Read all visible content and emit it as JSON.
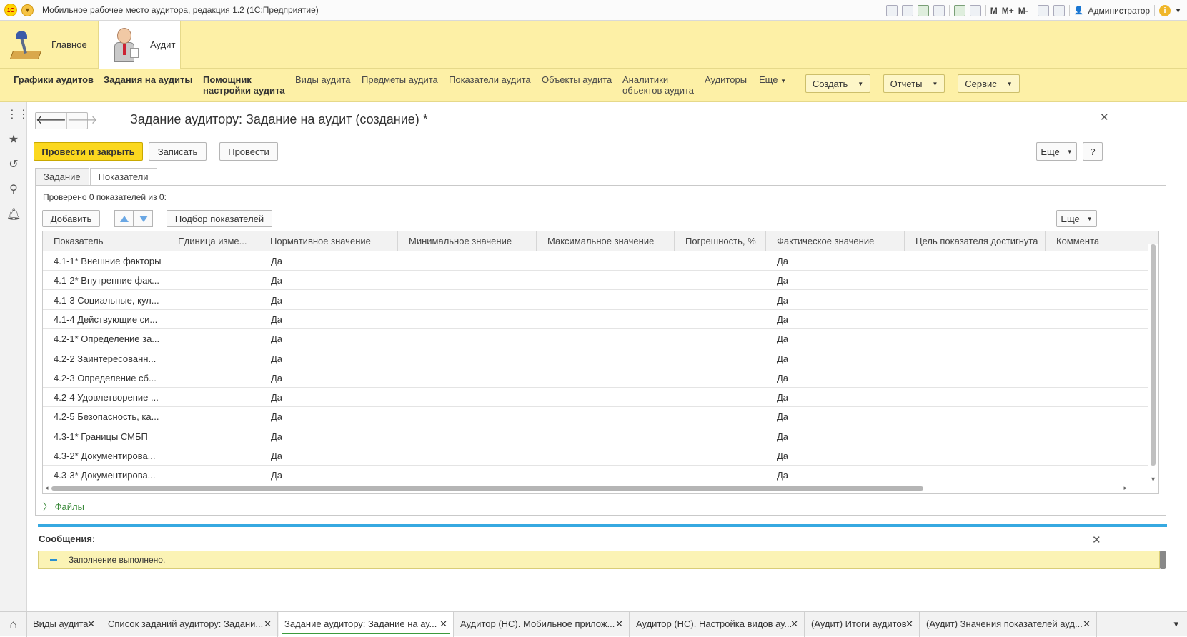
{
  "window": {
    "title": "Мобильное рабочее место аудитора, редакция 1.2  (1С:Предприятие)",
    "toolbar_texts": [
      "M",
      "M+",
      "M-"
    ],
    "user": "Администратор"
  },
  "sections": [
    {
      "label": "Главное",
      "icon": "desk-lamp-icon"
    },
    {
      "label": "Аудит",
      "icon": "auditor-icon"
    }
  ],
  "navbar": {
    "items": [
      {
        "label": "Графики аудитов",
        "bold": true
      },
      {
        "label": "Задания на аудиты",
        "bold": true
      },
      {
        "label": "Помощник\nнастройки аудита",
        "bold": true
      },
      {
        "label": "Виды аудита",
        "bold": false
      },
      {
        "label": "Предметы аудита",
        "bold": false
      },
      {
        "label": "Показатели аудита",
        "bold": false
      },
      {
        "label": "Объекты аудита",
        "bold": false
      },
      {
        "label": "Аналитики\nобъектов аудита",
        "bold": false
      },
      {
        "label": "Аудиторы",
        "bold": false
      }
    ],
    "more_label": "Еще",
    "buttons": [
      "Создать",
      "Отчеты",
      "Сервис"
    ]
  },
  "form": {
    "title": "Задание аудитору: Задание на аудит (создание) *",
    "post_close_label": "Провести и закрыть",
    "save_label": "Записать",
    "post_label": "Провести",
    "more_label": "Еще",
    "help_label": "?",
    "tabs": [
      "Задание",
      "Показатели"
    ],
    "active_tab": "Показатели",
    "checked_info": "Проверено 0 показателей из 0:",
    "add_label": "Добавить",
    "pick_label": "Подбор показателей",
    "table_more_label": "Еще",
    "columns": [
      "Показатель",
      "Единица изме...",
      "Нормативное значение",
      "Минимальное значение",
      "Максимальное значение",
      "Погрешность, %",
      "Фактическое значение",
      "Цель показателя достигнута",
      "Коммента"
    ],
    "rows": [
      {
        "indicator": "4.1-1* Внешние факторы",
        "normative": "Да",
        "actual": "Да"
      },
      {
        "indicator": "4.1-2* Внутренние фак...",
        "normative": "Да",
        "actual": "Да"
      },
      {
        "indicator": "4.1-3 Социальные, кул...",
        "normative": "Да",
        "actual": "Да"
      },
      {
        "indicator": "4.1-4 Действующие си...",
        "normative": "Да",
        "actual": "Да"
      },
      {
        "indicator": "4.2-1* Определение за...",
        "normative": "Да",
        "actual": "Да"
      },
      {
        "indicator": "4.2-2 Заинтересованн...",
        "normative": "Да",
        "actual": "Да"
      },
      {
        "indicator": "4.2-3 Определение сб...",
        "normative": "Да",
        "actual": "Да"
      },
      {
        "indicator": "4.2-4 Удовлетворение ...",
        "normative": "Да",
        "actual": "Да"
      },
      {
        "indicator": "4.2-5 Безопасность, ка...",
        "normative": "Да",
        "actual": "Да"
      },
      {
        "indicator": "4.3-1* Границы СМБП",
        "normative": "Да",
        "actual": "Да"
      },
      {
        "indicator": "4.3-2* Документирова...",
        "normative": "Да",
        "actual": "Да"
      },
      {
        "indicator": "4.3-3* Документирова...",
        "normative": "Да",
        "actual": "Да"
      }
    ],
    "files_label": "Файлы"
  },
  "messages": {
    "title": "Сообщения:",
    "items": [
      "Заполнение выполнено."
    ]
  },
  "bottom_tabs": [
    {
      "label": "Виды аудита",
      "active": false
    },
    {
      "label": "Список заданий аудитору: Задани...",
      "active": false
    },
    {
      "label": "Задание аудитору: Задание на ау...",
      "active": true
    },
    {
      "label": "Аудитор (НС). Мобильное прилож...",
      "active": false
    },
    {
      "label": "Аудитор (НС). Настройка видов ау...",
      "active": false
    },
    {
      "label": "(Аудит) Итоги аудитов",
      "active": false
    },
    {
      "label": "(Аудит) Значения показателей ауд...",
      "active": false
    }
  ],
  "colors": {
    "accent_yellow": "#fbd81f",
    "panel_yellow": "#fdf0a6",
    "message_blue": "#36a9e1",
    "link_green": "#3b8a3b"
  }
}
